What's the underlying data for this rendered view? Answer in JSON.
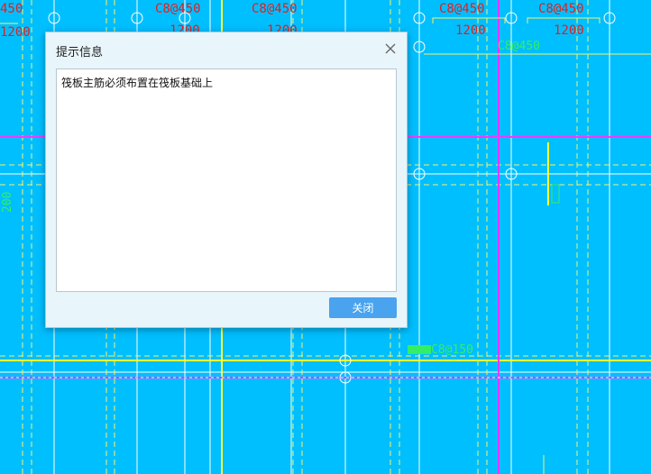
{
  "background_labels": {
    "top_left_partial": "450",
    "top_1": "C8@450",
    "top_2": "C8@450",
    "top_3": "C8@450",
    "top_4": "C8@450",
    "dim_left": "1200",
    "dim_1": "1200",
    "dim_2": "1200",
    "dim_3": "1200",
    "dim_4": "1200",
    "green_top": "C8@450",
    "green_bottom": "C8@150",
    "green_left_vertical": "200"
  },
  "dialog": {
    "title": "提示信息",
    "message": "筏板主筋必须布置在筏板基础上",
    "close_button": "关闭"
  },
  "colors": {
    "background": "#00bfff",
    "accent_button": "#4aa3ee"
  }
}
